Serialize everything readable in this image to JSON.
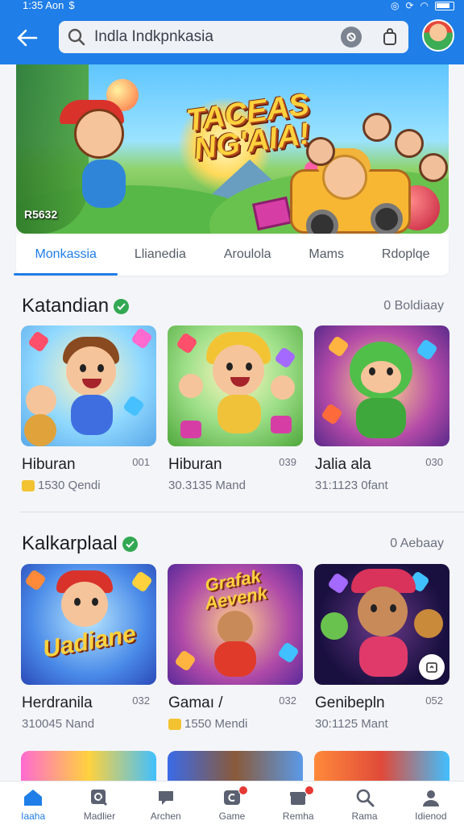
{
  "status_bar": {
    "time": "1:35 Aon",
    "extra": "$"
  },
  "app_bar": {
    "back_icon": "arrow-left-icon",
    "search_value": "Indla Indkpnkasia",
    "camera_icon": "camera-icon",
    "bag_icon": "shopping-bag-icon"
  },
  "banner": {
    "title": "TACEAS NG'AIA!",
    "tag": "R5632"
  },
  "tabs": [
    "Monkassia",
    "Llianedia",
    "Aroulola",
    "Mams",
    "Rdoplqe"
  ],
  "sections": [
    {
      "title": "Katandian",
      "more": "0 Boldiaay",
      "cards": [
        {
          "name": "Hiburan",
          "num": "001",
          "meta": "1530 Qendi",
          "has_coin": true
        },
        {
          "name": "Hiburan",
          "num": "039",
          "meta": "30.3135 Mand",
          "has_coin": false
        },
        {
          "name": "Jalia ala",
          "num": "030",
          "meta": "31:1123 0fant",
          "has_coin": false
        }
      ]
    },
    {
      "title": "Kalkarplaal",
      "more": "0 Aebaay",
      "cards": [
        {
          "name": "Herdranila",
          "num": "032",
          "meta": "310045 Nand",
          "has_coin": false,
          "thumb_text": "Uadiane"
        },
        {
          "name": "Gamaı /",
          "num": "032",
          "meta": "1550 Mendi",
          "has_coin": true,
          "thumb_text": "Grafak Aevenk"
        },
        {
          "name": "Genibepln",
          "num": "052",
          "meta": "30:1125 Mant",
          "has_coin": false
        }
      ]
    }
  ],
  "bottom_nav": [
    {
      "label": "Iaaha",
      "icon": "home-icon",
      "active": true
    },
    {
      "label": "Madlier",
      "icon": "search-doc-icon",
      "active": false
    },
    {
      "label": "Archen",
      "icon": "chat-icon",
      "active": false
    },
    {
      "label": "Game",
      "icon": "game-icon",
      "active": false,
      "badge": true
    },
    {
      "label": "Remha",
      "icon": "gift-icon",
      "active": false,
      "badge": true
    },
    {
      "label": "Rama",
      "icon": "search-icon",
      "active": false
    },
    {
      "label": "Idienod",
      "icon": "profile-icon",
      "active": false
    }
  ],
  "colors": {
    "accent": "#1f7ee8",
    "verified": "#32a853",
    "badge": "#e53935"
  }
}
